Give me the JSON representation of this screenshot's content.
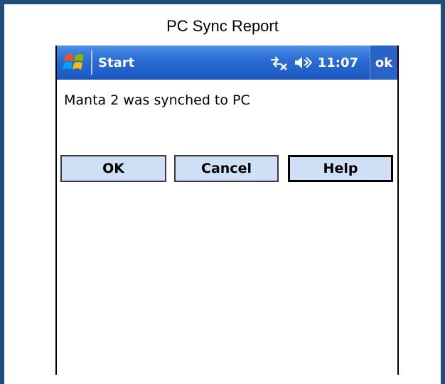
{
  "report": {
    "caption": "PC Sync Report"
  },
  "taskbar": {
    "start_label": "Start",
    "clock": "11:07",
    "ok_label": "ok",
    "icons": [
      "windows-flag-icon",
      "sync-disconnected-icon",
      "speaker-icon"
    ]
  },
  "dialog": {
    "message": "Manta 2 was synched to PC",
    "buttons": {
      "ok": "OK",
      "cancel": "Cancel",
      "help": "Help"
    }
  },
  "colors": {
    "frame": "#1f4e79",
    "titlebar": "#2b6fd6",
    "button_face": "#cfe0f6"
  }
}
